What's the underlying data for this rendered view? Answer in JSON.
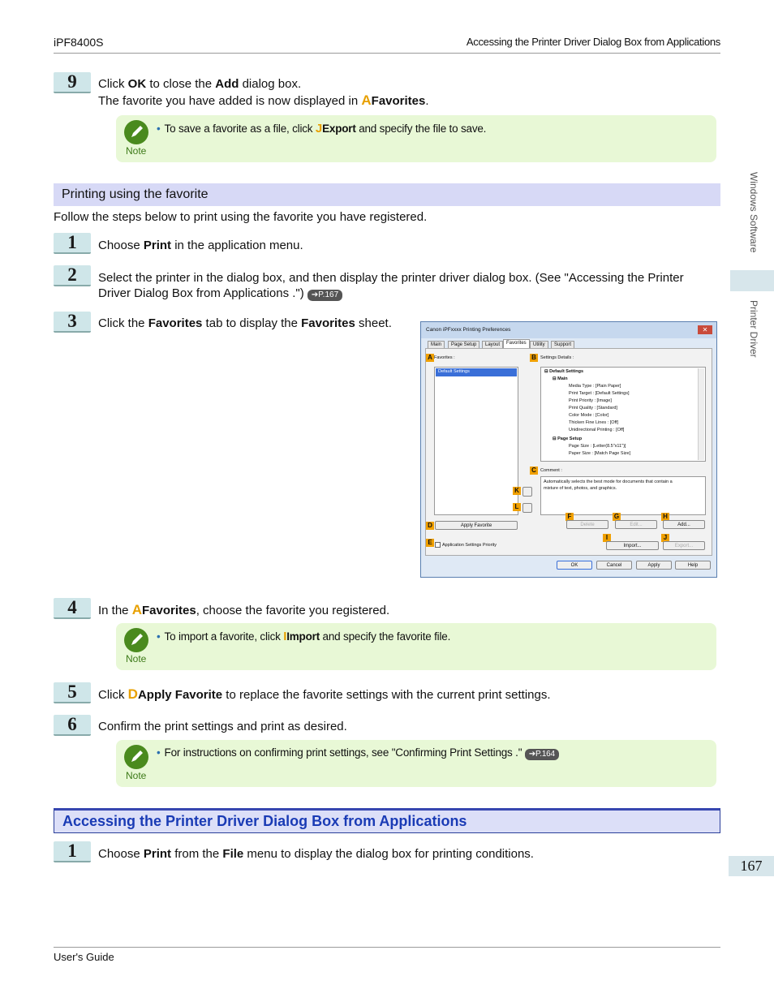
{
  "header": {
    "left": "iPF8400S",
    "right": "Accessing the Printer Driver Dialog Box from Applications"
  },
  "side": {
    "top": "Windows Software",
    "bottom": "Printer Driver",
    "page": "167"
  },
  "footer": "User's Guide",
  "step9": {
    "num": "9",
    "t1": "Click ",
    "b1": "OK",
    "t2": " to close the ",
    "b2": "Add",
    "t3": " dialog box.",
    "line2": "The favorite you have added is now displayed in ",
    "key": "A",
    "b3": "Favorites",
    "end": "."
  },
  "note1": {
    "label": "Note",
    "t1": "To save a favorite as a file, click ",
    "key": "J",
    "b1": "Export",
    "t2": " and specify the file to save."
  },
  "section1": "Printing using the favorite",
  "intro": "Follow the steps below to print using the favorite you have registered.",
  "s1": {
    "num": "1",
    "t1": "Choose ",
    "b1": "Print",
    "t2": " in the application menu."
  },
  "s2": {
    "num": "2",
    "line1": "Select the printer in the dialog box, and then display the printer driver dialog box.  (See \"Accessing the Printer",
    "line2": "Driver Dialog Box from Applications .\")",
    "ref": "➔P.167"
  },
  "s3": {
    "num": "3",
    "t1": "Click the ",
    "b1": "Favorites",
    "t2": " tab to display the ",
    "b2": "Favorites",
    "t3": " sheet."
  },
  "s4": {
    "num": "4",
    "t1": "In the ",
    "key": "A",
    "b1": "Favorites",
    "t2": ", choose the favorite you registered."
  },
  "note2": {
    "label": "Note",
    "t1": "To import a favorite, click ",
    "key": "I",
    "b1": "Import",
    "t2": " and specify the favorite file."
  },
  "s5": {
    "num": "5",
    "t1": "Click ",
    "key": "D",
    "b1": "Apply Favorite",
    "t2": " to replace the favorite settings with the current print settings."
  },
  "s6": {
    "num": "6",
    "t1": "Confirm the print settings and print as desired."
  },
  "note3": {
    "label": "Note",
    "t1": "For instructions on confirming print settings, see \"Confirming Print Settings .\"",
    "ref": "➔P.164"
  },
  "section2": "Accessing the Printer Driver Dialog Box from Applications",
  "s7": {
    "num": "1",
    "t1": "Choose ",
    "b1": "Print",
    "t2": " from the ",
    "b2": "File",
    "t3": " menu to display the dialog box for printing conditions."
  },
  "dialog": {
    "title": "Canon iPFxxxx Printing Preferences",
    "close": "✕",
    "tabs": [
      "Main",
      "Page Setup",
      "Layout",
      "Favorites",
      "Utility",
      "Support"
    ],
    "favorites_label": "Favorites :",
    "favorites_item": "Default Settings",
    "details_label": "Settings Details :",
    "tree": [
      "⊟ Default Settings",
      "⊟ Main",
      "Media Type : [Plain Paper]",
      "Print Target : [Default Settings]",
      "Print Priority : [Image]",
      "Print Quality : [Standard]",
      "Color Mode : [Color]",
      "Thicken Fine Lines : [Off]",
      "Unidirectional Printing : [Off]",
      "⊟ Page Setup",
      "Page Size : [Letter(8.5\"x11\")]",
      "Paper Size : [Match Page Size]"
    ],
    "comment_label": "Comment :",
    "comment_line1": "Automatically selects the best mode for documents that contain a",
    "comment_line2": "mixture of text, photos, and graphics.",
    "apply_favorite": "Apply Favorite",
    "delete": "Delete",
    "edit": "Edit...",
    "add": "Add...",
    "app_priority": "Application Settings Priority",
    "import": "Import...",
    "export": "Export...",
    "ok": "OK",
    "cancel": "Cancel",
    "apply": "Apply",
    "help": "Help",
    "keys": [
      "A",
      "B",
      "C",
      "D",
      "E",
      "F",
      "G",
      "H",
      "I",
      "J",
      "K",
      "L"
    ]
  }
}
